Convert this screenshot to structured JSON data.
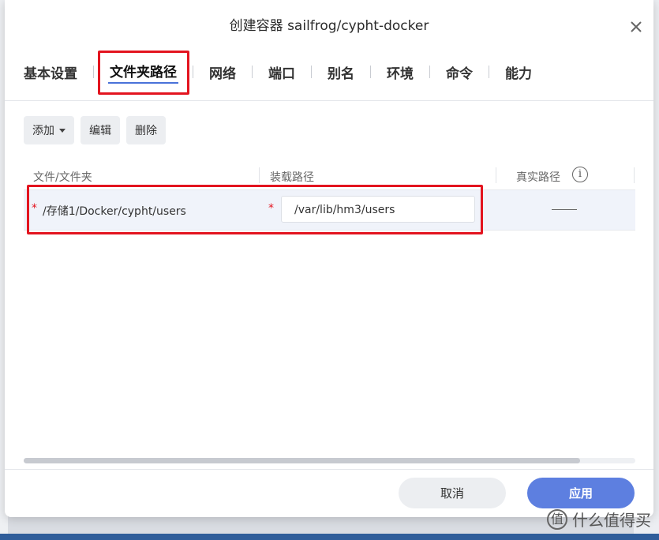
{
  "dialog": {
    "title": "创建容器 sailfrog/cypht-docker"
  },
  "tabs": [
    {
      "label": "基本设置"
    },
    {
      "label": "文件夹路径"
    },
    {
      "label": "网络"
    },
    {
      "label": "端口"
    },
    {
      "label": "别名"
    },
    {
      "label": "环境"
    },
    {
      "label": "命令"
    },
    {
      "label": "能力"
    }
  ],
  "active_tab_index": 1,
  "toolbar": {
    "add_label": "添加",
    "edit_label": "编辑",
    "delete_label": "删除"
  },
  "table": {
    "columns": [
      "文件/文件夹",
      "装载路径",
      "真实路径"
    ],
    "rows": [
      {
        "source": "/存储1/Docker/cypht/users",
        "mount": "/var/lib/hm3/users",
        "real": "——"
      }
    ],
    "required_mark": "*"
  },
  "footer": {
    "cancel_label": "取消",
    "apply_label": "应用"
  },
  "watermark": {
    "text": "什么值得买",
    "logo": "值"
  },
  "colors": {
    "accent": "#5d7fe0",
    "annotation": "#e3141f"
  }
}
